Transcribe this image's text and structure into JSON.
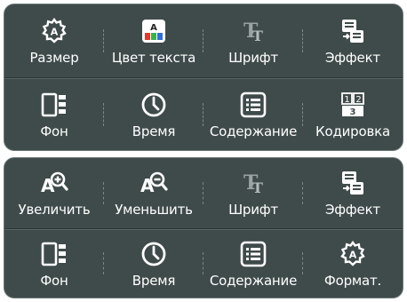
{
  "panel_top": {
    "row1": [
      {
        "label": "Размер",
        "icon": "gear-a-icon"
      },
      {
        "label": "Цвет текста",
        "icon": "color-grid-icon"
      },
      {
        "label": "Шрифт",
        "icon": "font-tt-icon",
        "dim": true
      },
      {
        "label": "Эффект",
        "icon": "effect-icon"
      }
    ],
    "row2": [
      {
        "label": "Фон",
        "icon": "background-icon"
      },
      {
        "label": "Время",
        "icon": "clock-icon"
      },
      {
        "label": "Содержание",
        "icon": "list-icon"
      },
      {
        "label": "Кодировка",
        "icon": "encoding-icon",
        "encoding_digits": [
          "1",
          "2",
          "3"
        ]
      }
    ]
  },
  "panel_bottom": {
    "row1": [
      {
        "label": "Увеличить",
        "icon": "zoom-in-a-icon"
      },
      {
        "label": "Уменьшить",
        "icon": "zoom-out-a-icon"
      },
      {
        "label": "Шрифт",
        "icon": "font-tt-icon",
        "dim": true
      },
      {
        "label": "Эффект",
        "icon": "effect-icon"
      }
    ],
    "row2": [
      {
        "label": "Фон",
        "icon": "background-icon"
      },
      {
        "label": "Время",
        "icon": "clock-icon"
      },
      {
        "label": "Содержание",
        "icon": "list-icon"
      },
      {
        "label": "Формат.",
        "icon": "gear-a-icon"
      }
    ]
  },
  "colors": {
    "panel_bg": "#3f4b4a",
    "text": "#ffffff",
    "icon_dim": "#9aa3a2",
    "color_red": "#e23b2e",
    "color_green": "#35b44a",
    "color_blue": "#2f6fd8"
  }
}
